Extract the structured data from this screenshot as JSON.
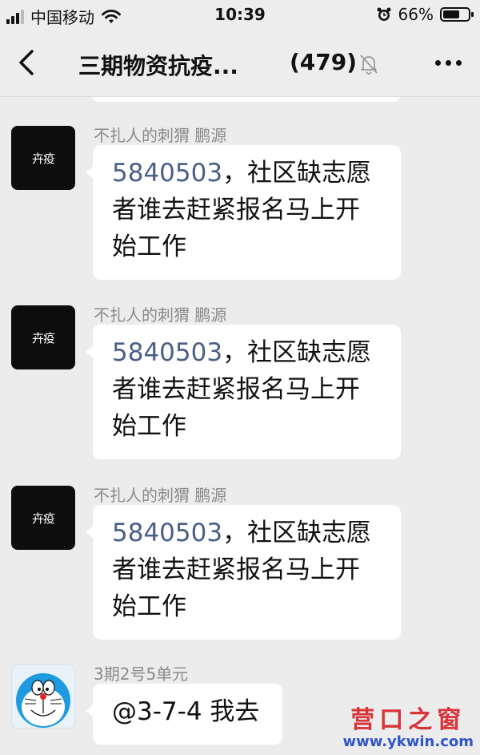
{
  "status_bar": {
    "carrier": "中国移动",
    "time": "10:39",
    "battery_text": "66%",
    "battery_level": 0.66
  },
  "nav": {
    "title": "三期物资抗疫...",
    "member_count": "(479)"
  },
  "messages": [
    {
      "sender": "不扎人的刺猬 鹏源",
      "avatar": "卉疫",
      "number": "5840503",
      "text": "，社区缺志愿者谁去赶紧报名马上开始工作"
    },
    {
      "sender": "不扎人的刺猬 鹏源",
      "avatar": "卉疫",
      "number": "5840503",
      "text": "，社区缺志愿者谁去赶紧报名马上开始工作"
    },
    {
      "sender": "不扎人的刺猬 鹏源",
      "avatar": "卉疫",
      "number": "5840503",
      "text": "，社区缺志愿者谁去赶紧报名马上开始工作"
    },
    {
      "sender": "3期2号5单元",
      "text": "@3-7-4 我去"
    }
  ],
  "watermark": {
    "cn": "营口之窗",
    "url": "www.ykwin.com"
  },
  "colors": {
    "background": "#ececec",
    "bubble": "#ffffff",
    "link": "#4a5f86",
    "watermark_red": "#d8343a",
    "watermark_blue": "#2f55c8"
  }
}
